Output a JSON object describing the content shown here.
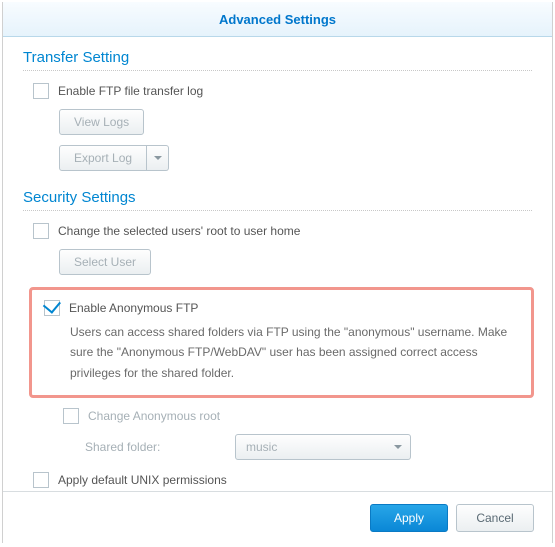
{
  "title": "Advanced Settings",
  "sections": {
    "transfer": {
      "header": "Transfer Setting",
      "enable_log": {
        "label": "Enable FTP file transfer log",
        "checked": false
      },
      "view_logs_btn": "View Logs",
      "export_log_btn": "Export Log"
    },
    "security": {
      "header": "Security Settings",
      "change_root": {
        "label": "Change the selected users' root to user home",
        "checked": false
      },
      "select_user_btn": "Select User",
      "enable_anon": {
        "label": "Enable Anonymous FTP",
        "checked": true
      },
      "anon_desc": "Users can access shared folders via FTP using the \"anonymous\" username. Make sure the \"Anonymous FTP/WebDAV\" user has been assigned correct access privileges for the shared folder.",
      "change_anon_root": {
        "label": "Change Anonymous root",
        "checked": false
      },
      "shared_folder": {
        "label": "Shared folder:",
        "value": "music"
      },
      "apply_unix": {
        "label": "Apply default UNIX permissions",
        "checked": false
      }
    }
  },
  "footer": {
    "apply": "Apply",
    "cancel": "Cancel"
  }
}
